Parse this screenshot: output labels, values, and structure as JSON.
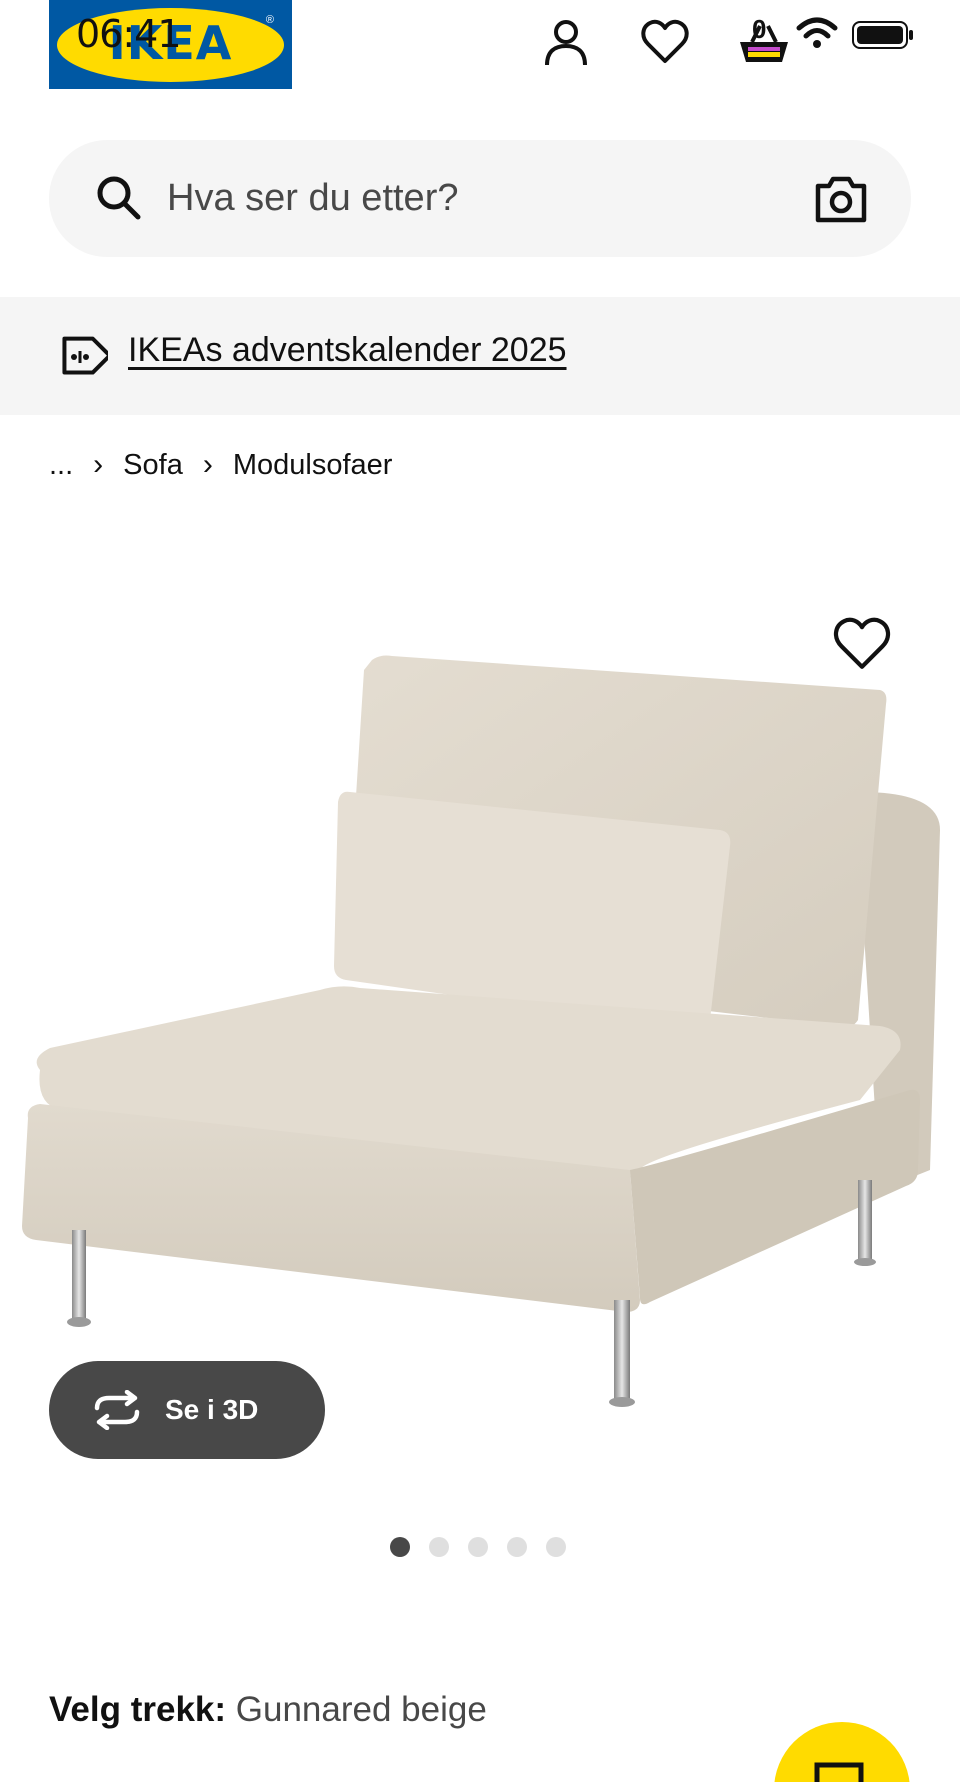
{
  "status_bar": {
    "time": "06:41"
  },
  "header": {
    "logo_text": "IKEA",
    "logo_reg": "®",
    "cart_count": "0",
    "icons": [
      "user-icon",
      "heart-icon",
      "cart-icon"
    ]
  },
  "search": {
    "placeholder": "Hva ser du etter?"
  },
  "promo": {
    "text": "IKEAs adventskalender 2025"
  },
  "breadcrumb": {
    "ellipsis": "...",
    "items": [
      "Sofa",
      "Modulsofaer"
    ]
  },
  "product": {
    "view_3d_label": "Se i 3D",
    "gallery_total": 5,
    "gallery_active": 1
  },
  "cover": {
    "label": "Velg trekk:",
    "value": "Gunnared beige"
  },
  "colors": {
    "brand_blue": "#0058a3",
    "brand_yellow": "#ffdb00",
    "dark_button": "#484848"
  }
}
